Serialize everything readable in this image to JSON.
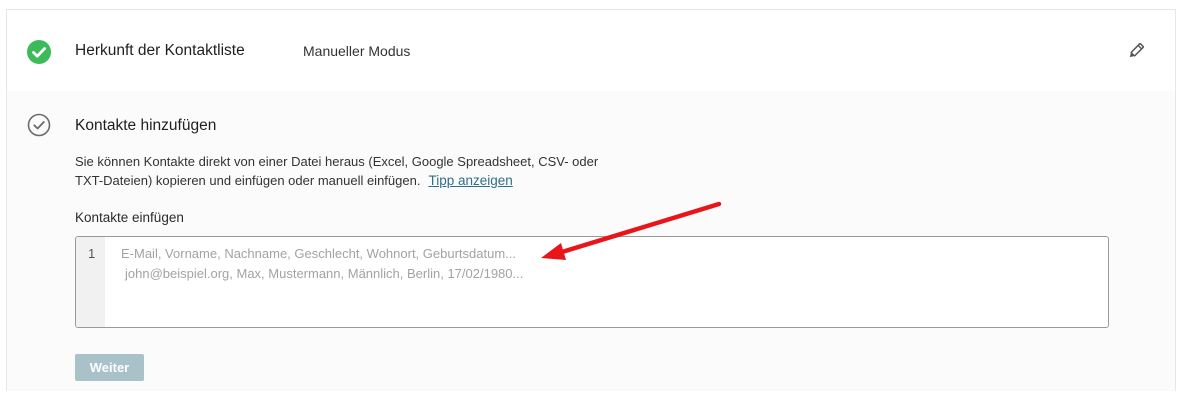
{
  "step1": {
    "title": "Herkunft der Kontaktliste",
    "value": "Manueller Modus",
    "status_icon": "check-circle-filled-icon",
    "edit_icon": "pencil-icon"
  },
  "step2": {
    "title": "Kontakte hinzufügen",
    "status_icon": "check-circle-outline-icon",
    "description_line1": "Sie können Kontakte direkt von einer Datei heraus (Excel, Google Spreadsheet, CSV- oder",
    "description_line2": "TXT-Dateien) kopieren und einfügen oder manuell einfügen.",
    "tip_link": "Tipp anzeigen",
    "field_label": "Kontakte einfügen",
    "editor": {
      "line_number": "1",
      "placeholder_line1": "E-Mail, Vorname, Nachname, Geschlecht, Wohnort, Geburtsdatum...",
      "placeholder_line2": "john@beispiel.org, Max, Mustermann, Männlich, Berlin, 17/02/1980..."
    },
    "next_button": "Weiter"
  },
  "colors": {
    "success": "#3dbb5a",
    "outline_icon": "#6b6b6b",
    "link": "#2e6f8a",
    "button_disabled": "#a9c1c9",
    "annotation_arrow": "#e8161a"
  }
}
